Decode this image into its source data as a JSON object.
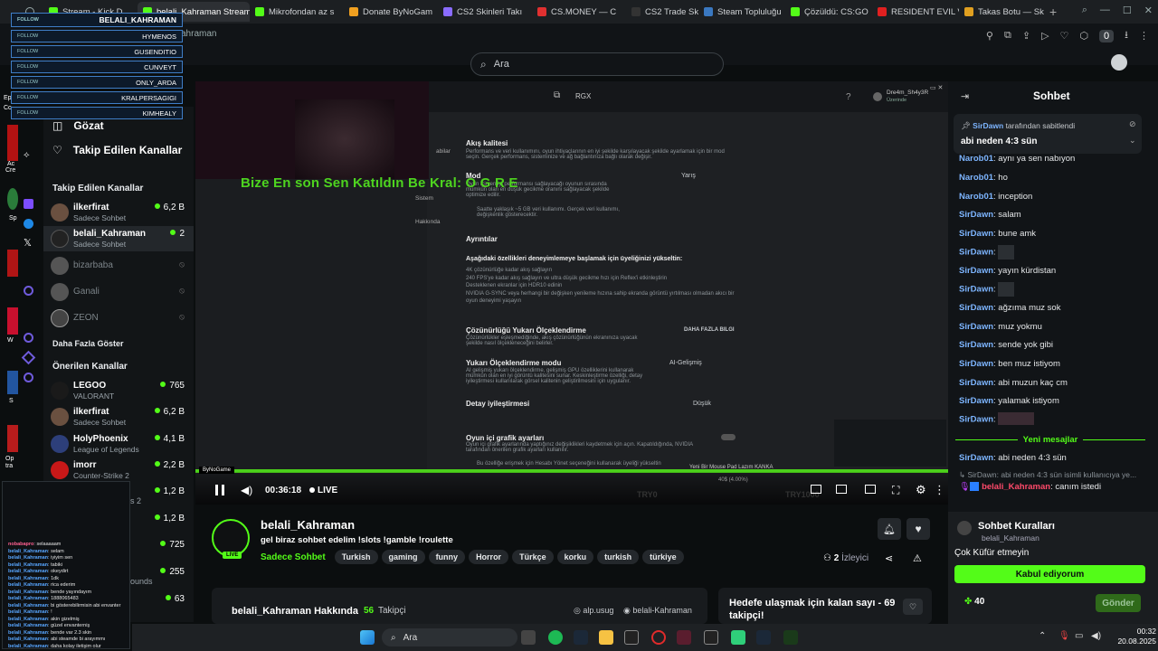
{
  "browser": {
    "tabs": [
      {
        "label": "Stream - Kick D",
        "color": "#53fc18"
      },
      {
        "label": "belali_Kahraman Stream",
        "color": "#53fc18",
        "active": true
      },
      {
        "label": "Mikrofondan az s",
        "color": "#53fc18"
      },
      {
        "label": "Donate ByNoGam",
        "color": "#f0a020"
      },
      {
        "label": "CS2 Skinleri Takı",
        "color": "#8a6cff"
      },
      {
        "label": "CS.MONEY — C",
        "color": "#e03030"
      },
      {
        "label": "CS2 Trade Skins",
        "color": "#2a2a2a"
      },
      {
        "label": "Steam Topluluğu",
        "color": "#3a78c0"
      },
      {
        "label": "Çözüldü: CS:GO",
        "color": "#53fc18"
      },
      {
        "label": "RESIDENT EVIL V",
        "color": "#e02020"
      },
      {
        "label": "Takas Botu — Sk",
        "color": "#e0a020"
      }
    ],
    "breadcrumb": "ahraman",
    "extension_count": "0"
  },
  "search": {
    "placeholder": "Ara"
  },
  "follow_overlay": {
    "title": "BELALI_KAHRAMAN",
    "follow_tag": "FOLLOW",
    "names": [
      "HYMENOS",
      "GUSENDITIO",
      "CUNVEYT",
      "ONLY_ARDA",
      "KRALPERSAGIGI",
      "KIMHEALY"
    ]
  },
  "sidebar": {
    "nav": [
      {
        "label": "Gözat"
      },
      {
        "label": "Takip Edilen Kanallar"
      }
    ],
    "followed_heading": "Takip Edilen Kanallar",
    "followed": [
      {
        "name": "ilkerfirat",
        "sub": "Sadece Sohbet",
        "viewers": "6,2 B"
      },
      {
        "name": "belali_Kahraman",
        "sub": "Sadece Sohbet",
        "viewers": "2"
      },
      {
        "name": "bizarbaba",
        "offline": true
      },
      {
        "name": "Ganali",
        "offline": true
      },
      {
        "name": "ZEON",
        "offline": true
      }
    ],
    "show_more": "Daha Fazla Göster",
    "recommended_heading": "Önerilen Kanallar",
    "recommended": [
      {
        "name": "LEGOO",
        "sub": "VALORANT",
        "viewers": "765"
      },
      {
        "name": "ilkerfirat",
        "sub": "Sadece Sohbet",
        "viewers": "6,2 B"
      },
      {
        "name": "HolyPhoenix",
        "sub": "League of Legends",
        "viewers": "4,1 B"
      },
      {
        "name": "imorr",
        "sub": "Counter-Strike 2",
        "viewers": "2,2 B"
      },
      {
        "viewers": "1,2 B"
      },
      {
        "viewers": "1,2 B"
      },
      {
        "viewers": "725"
      },
      {
        "viewers": "255"
      },
      {
        "viewers": "63"
      }
    ],
    "partial_texts": [
      "s 2",
      "ounds"
    ]
  },
  "video": {
    "ticker": "Bize En son Sen Katıldın Be Kral: O G R E",
    "time": "00:36:18",
    "live_label": "LIVE",
    "sponsor": "ByNoGame",
    "banner_text": "Yeni Bir Mouse Pad Lazım KANKA",
    "goal_left": "TRY0",
    "goal_mid": "40$ (4.00%)",
    "goal_right": "TRY1000",
    "goal_progress": 0.04,
    "game": {
      "header_user": "Dre4m_Sh4y3R",
      "header_status": "Üzerinde",
      "app_label": "RGX",
      "left_menu": [
        "abilar",
        "Sistem",
        "Hakkında"
      ],
      "sections": [
        {
          "title": "Akış kalitesi",
          "desc": "Performans ve veri kullanımını, oyun ihtiyaçlarının en iyi şekilde karşılayacak şekilde ayarlamak için bir mod seçin. Gerçek performans, sisteminize ve ağ bağlantınıza bağlı olarak değişir."
        },
        {
          "title": "Mod",
          "value": "Yarış",
          "desc": "Oyun için en iyi performansı sağlayacağı oyunun sırasında mümkün olan en düşük gecikme oranını sağlayacak şekilde optimize edilir."
        },
        {
          "note": "Saatte yaklaşık ~5 GB veri kullanımı. Gerçek veri kullanımı, değişkenlik gösterecektir."
        },
        {
          "title": "Ayrıntılar"
        },
        {
          "title": "Aşağıdaki özellikleri deneyimlemeye başlamak için üyeliğinizi yükseltin:"
        },
        {
          "bullets": [
            "4K çözünürlüğe kadar akış sağlayın",
            "240 FPS'ye kadar akış sağlayın ve ultra düşük gecikme hızı için Reflex'i etkinleştirin",
            "Desteklenen ekranlar için HDR10 edinin",
            "NVIDIA G-SYNC veya herhangi bir değişken yenileme hızına sahip ekranda görüntü yırtılması olmadan akıcı bir oyun deneyimi yaşayın"
          ]
        },
        {
          "title": "Çözünürlüğü Yukarı Ölçeklendirme",
          "value": "DAHA FAZLA BILGI",
          "desc": "Çözünürlükler eşleşmediğinde, akış çözünürlüğünün ekranınıza uyacak şekilde nasıl ölçekleneceğini belirler."
        },
        {
          "title": "Yukarı Ölçeklendirme modu",
          "value": "AI-Gelişmiş",
          "desc": "AI gelişmiş yukarı ölçeklendirme, gelişmiş GPU özelliklerini kullanarak mümkün olan en iyi görüntü kalitesini sunar. Keskinleştirme özelliği, detay iyileştirmesi kullanılarak görsel kalitenin geliştirilmesini için uygulanır."
        },
        {
          "title": "Detay iyileştirmesi",
          "value": "Düşük"
        },
        {
          "title": "Oyun içi grafik ayarları",
          "desc": "Oyun içi grafik ayarlarında yaptığınız değişiklikleri kaydetmek için açın. Kapatıldığında, NVIDIA tarafından önerilen grafik ayarları kullanılır."
        },
        {
          "note": "Bu özelliğe erişmek için Hesabı Yönet seçeneğini kullanarak üyeliği yükseltin"
        }
      ]
    }
  },
  "stream_info": {
    "name": "belali_Kahraman",
    "live_badge": "LIVE",
    "title": "gel biraz sohbet edelim  !slots !gamble !roulette",
    "category": "Sadece Sohbet",
    "tags": [
      "Turkish",
      "gaming",
      "funny",
      "Horror",
      "Türkçe",
      "korku",
      "turkish",
      "türkiye"
    ],
    "viewers": "2",
    "viewers_label": "İzleyici",
    "about": "belali_Kahraman Hakkında",
    "followers": "56",
    "followers_label": "Takipçi",
    "instagram": "alp.usug",
    "kick": "belali-Kahraman",
    "goal_title": "Hedefe ulaşmak için kalan sayı - 69 takipçi!"
  },
  "chat": {
    "title": "Sohbet",
    "pinned_by": "SirDawn",
    "pinned_label": "tarafından sabitlendi",
    "pinned_msg": "abi neden 4:3 sün",
    "messages": [
      {
        "user": "Narob01",
        "text": "aynı ya sen nabıyon"
      },
      {
        "user": "Narob01",
        "text": "ho"
      },
      {
        "user": "Narob01",
        "text": "inception"
      },
      {
        "user": "SirDawn",
        "text": "salam"
      },
      {
        "user": "SirDawn",
        "text": "bune amk"
      },
      {
        "user": "SirDawn",
        "text": "",
        "emote": 1
      },
      {
        "user": "SirDawn",
        "text": "yayın kürdistan"
      },
      {
        "user": "SirDawn",
        "text": "",
        "emote": 1
      },
      {
        "user": "SirDawn",
        "text": "ağzıma muz sok"
      },
      {
        "user": "SirDawn",
        "text": "muz yokmu"
      },
      {
        "user": "SirDawn",
        "text": "sende yok gibi"
      },
      {
        "user": "SirDawn",
        "text": "ben muz istiyom"
      },
      {
        "user": "SirDawn",
        "text": "abi muzun kaç cm"
      },
      {
        "user": "SirDawn",
        "text": "yalamak istiyom"
      },
      {
        "user": "SirDawn",
        "text": "",
        "emote": 3
      }
    ],
    "new_messages": "Yeni mesajlar",
    "after_new": [
      {
        "user": "SirDawn",
        "text": "abi neden 4:3 sün"
      }
    ],
    "reply_preview": "SirDawn: abi neden 4:3 sün isimli kullanıcıya ye...",
    "reply_user": "belali_Kahraman",
    "reply_text": "canım istedi",
    "rules_title": "Sohbet Kuralları",
    "rules_owner": "belali_Kahraman",
    "rule": "Çok Küfür etmeyin",
    "accept": "Kabul ediyorum",
    "points": "40",
    "send": "Gönder"
  },
  "overlay_chat": [
    {
      "user": "nobabapro",
      "text": "selaaaaam"
    },
    {
      "user": "belali_Kahraman",
      "text": "selam"
    },
    {
      "user": "belali_Kahraman",
      "text": "iyiyim sen"
    },
    {
      "user": "belali_Kahraman",
      "text": "tabiki"
    },
    {
      "user": "belali_Kahraman",
      "text": "okeydirt"
    },
    {
      "user": "belali_Kahraman",
      "text": "1dk"
    },
    {
      "user": "belali_Kahraman",
      "text": "rica ederim"
    },
    {
      "user": "belali_Kahraman",
      "text": "bende yayındayım"
    },
    {
      "user": "belali_Kahraman",
      "text": "1888065483"
    },
    {
      "user": "belali_Kahraman",
      "text": "bi gösterebilirmisin abi envanter"
    },
    {
      "user": "belali_Kahraman",
      "text": "!"
    },
    {
      "user": "belali_Kahraman",
      "text": "akin gizelmiş"
    },
    {
      "user": "belali_Kahraman",
      "text": "güzel envanterniş"
    },
    {
      "user": "belali_Kahraman",
      "text": "bende var 2.3 skin"
    },
    {
      "user": "belali_Kahraman",
      "text": "abi steamde bi arayımmı"
    },
    {
      "user": "belali_Kahraman",
      "text": "daha kolay iletişim olur"
    }
  ],
  "desktop": {
    "left_labels": [
      "Eps",
      "Co",
      "Ac",
      "Cre",
      "Sp",
      "W",
      "S",
      "Op",
      "tra"
    ]
  },
  "taskbar": {
    "search_placeholder": "Ara",
    "time": "00:32",
    "date": "20.08.2025"
  },
  "colors": {
    "accent": "#53fc18",
    "link": "#7db5ff",
    "bg": "#0b0e0f"
  }
}
